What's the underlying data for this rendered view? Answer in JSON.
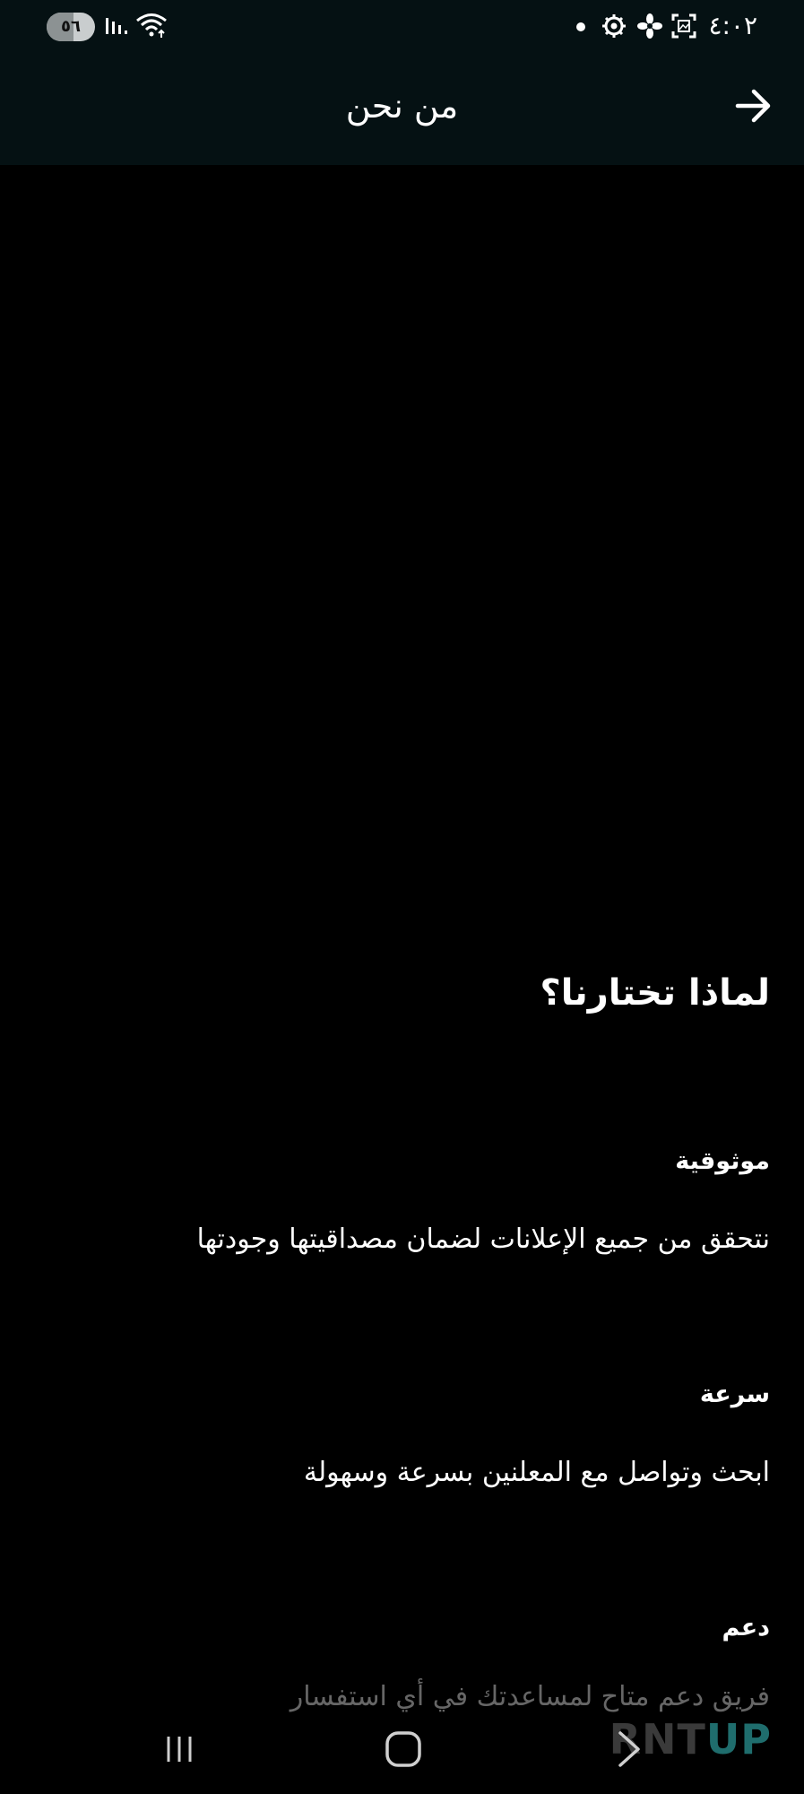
{
  "status_bar": {
    "time": "٤:٠٢",
    "battery_level": "٥٦",
    "battery_fraction": 0.56,
    "icons": [
      "dot-icon",
      "gear-icon",
      "flower-icon",
      "screenshot-icon",
      "wifi-icon",
      "signal-icon"
    ]
  },
  "app_bar": {
    "title": "من نحن",
    "back_icon": "arrow-right-icon"
  },
  "content": {
    "heading": "لماذا تختارنا؟",
    "features": [
      {
        "title": "موثوقية",
        "description": "نتحقق من جميع الإعلانات لضمان مصداقيتها وجودتها"
      },
      {
        "title": "سرعة",
        "description": "ابحث وتواصل مع المعلنين بسرعة وسهولة"
      },
      {
        "title": "دعم",
        "description": "فريق دعم متاح لمساعدتك في أي استفسار"
      }
    ]
  },
  "nav_bar": {
    "icons": [
      "recents-icon",
      "home-icon",
      "back-icon"
    ]
  },
  "watermark": {
    "part1": "RNT",
    "part2": "UP"
  },
  "colors": {
    "bar_background": "#051113",
    "content_background": "#000000",
    "text": "#ffffff",
    "watermark_accent": "#1f6d6d"
  }
}
